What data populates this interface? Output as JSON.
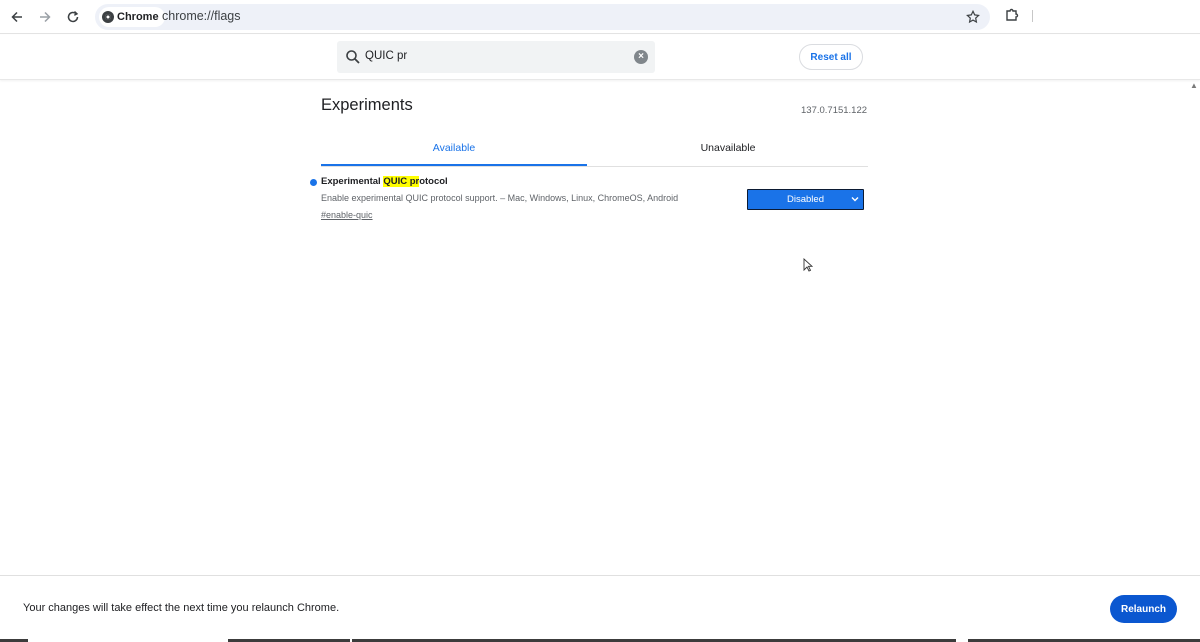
{
  "browser": {
    "back_icon": "arrow-left-icon",
    "forward_icon": "arrow-right-icon",
    "reload_icon": "reload-icon",
    "chip_label": "Chrome",
    "url": "chrome://flags",
    "bookmark_icon": "star-icon",
    "extensions_icon": "puzzle-icon"
  },
  "search": {
    "value": "QUIC pr",
    "clear_icon": "clear-icon"
  },
  "header": {
    "reset_label": "Reset all"
  },
  "page": {
    "title": "Experiments",
    "version": "137.0.7151.122",
    "tabs": [
      {
        "label": "Available",
        "active": true
      },
      {
        "label": "Unavailable",
        "active": false
      }
    ]
  },
  "flags": [
    {
      "title_prefix": "Experimental ",
      "title_highlight": "QUIC pr",
      "title_suffix": "otocol",
      "description": "Enable experimental QUIC protocol support. – Mac, Windows, Linux, ChromeOS, Android",
      "link": "#enable-quic",
      "selected_value": "Disabled"
    }
  ],
  "bottom": {
    "message": "Your changes will take effect the next time you relaunch Chrome.",
    "relaunch_label": "Relaunch"
  },
  "colors": {
    "accent": "#1a73e8",
    "relaunch": "#0b57d0",
    "highlight": "#ffff00"
  }
}
